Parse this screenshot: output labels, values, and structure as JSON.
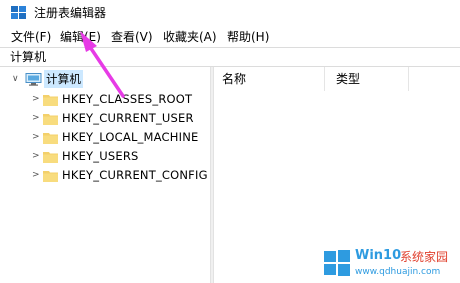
{
  "window": {
    "title": "注册表编辑器"
  },
  "menu": [
    {
      "label": "文件(F)"
    },
    {
      "label": "编辑(E)"
    },
    {
      "label": "查看(V)"
    },
    {
      "label": "收藏夹(A)"
    },
    {
      "label": "帮助(H)"
    }
  ],
  "address": {
    "path": "计算机"
  },
  "tree": {
    "root": {
      "label": "计算机",
      "toggle": "∨"
    },
    "children": [
      {
        "label": "HKEY_CLASSES_ROOT",
        "toggle": ">"
      },
      {
        "label": "HKEY_CURRENT_USER",
        "toggle": ">"
      },
      {
        "label": "HKEY_LOCAL_MACHINE",
        "toggle": ">"
      },
      {
        "label": "HKEY_USERS",
        "toggle": ">"
      },
      {
        "label": "HKEY_CURRENT_CONFIG",
        "toggle": ">"
      }
    ]
  },
  "list": {
    "columns": [
      {
        "label": "名称"
      },
      {
        "label": "类型"
      }
    ]
  },
  "watermark": {
    "brand": "Win10",
    "site_cn": "系统家园",
    "site_url": "www.qdhuajin.com"
  },
  "colors": {
    "arrow": "#e73be6",
    "folder": "#f3d06b",
    "selection": "#cce8ff",
    "app_icon": "#1f6fc1"
  },
  "icons": {
    "app": "registry-editor-icon",
    "computer": "computer-icon",
    "folder": "folder-icon",
    "annotation": "pointer-arrow"
  }
}
